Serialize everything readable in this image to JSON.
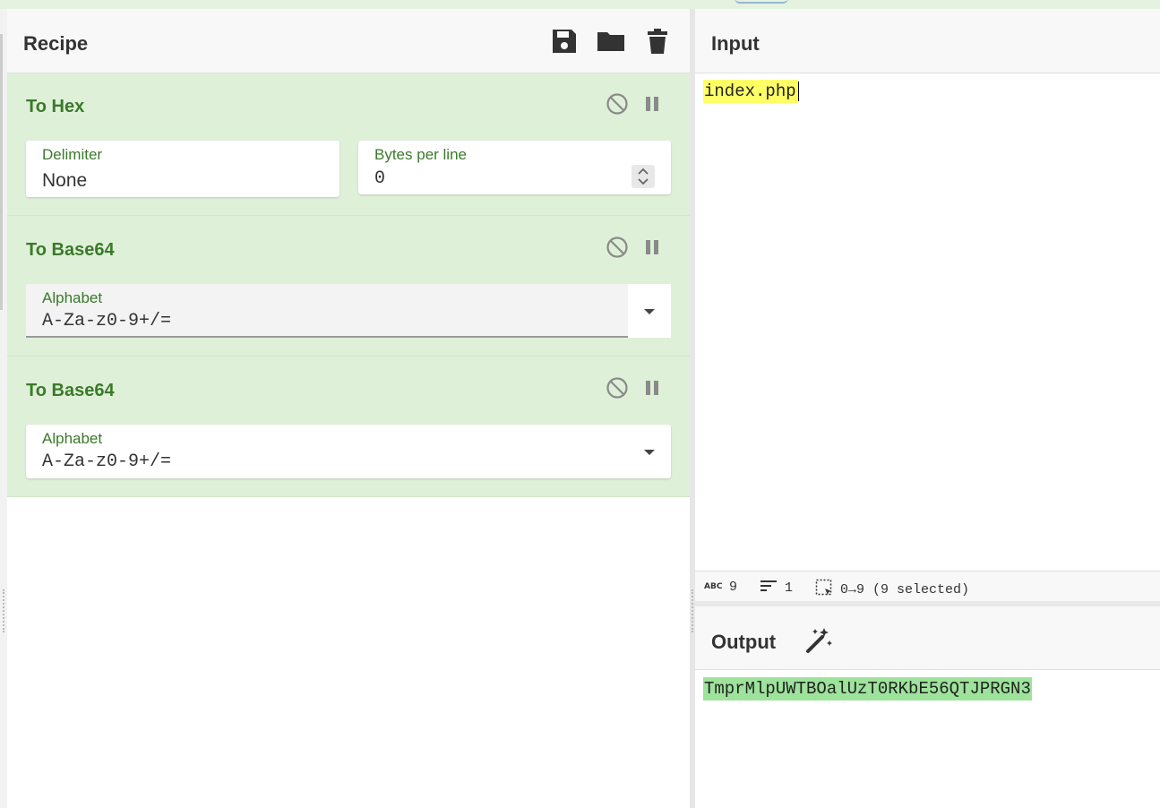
{
  "recipe": {
    "title": "Recipe",
    "operations": [
      {
        "name": "To Hex",
        "fields": [
          {
            "label": "Delimiter",
            "value": "None"
          },
          {
            "label": "Bytes per line",
            "value": "0"
          }
        ]
      },
      {
        "name": "To Base64",
        "fields": [
          {
            "label": "Alphabet",
            "value": "A-Za-z0-9+/="
          }
        ]
      },
      {
        "name": "To Base64",
        "fields": [
          {
            "label": "Alphabet",
            "value": "A-Za-z0-9+/="
          }
        ]
      }
    ]
  },
  "input": {
    "title": "Input",
    "text": "index.php"
  },
  "status": {
    "chars": "9",
    "lines": "1",
    "selection": "0→9 (9 selected)"
  },
  "output": {
    "title": "Output",
    "text": "TmprMlpUWTBOalUzT0RKbE56QTJPRGN3"
  },
  "colors": {
    "op_bg": "#dff0d8",
    "op_title": "#3a7a2a",
    "input_highlight": "#ffff66",
    "output_highlight": "#9de39b"
  },
  "icons": [
    "save-icon",
    "folder-icon",
    "trash-icon",
    "disable-icon",
    "pause-icon",
    "dropdown-caret-icon",
    "spinner-icon",
    "abc-icon",
    "lines-icon",
    "selection-icon",
    "magic-wand-icon"
  ]
}
